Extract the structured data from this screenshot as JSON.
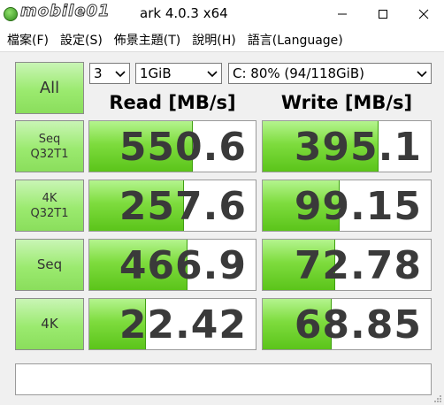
{
  "window": {
    "title": "CrystalDiskMark 4.0.3 x64",
    "title_visible": "ark 4.0.3 x64",
    "logo_watermark": "mobile01"
  },
  "menu": [
    {
      "label": "檔案(F)"
    },
    {
      "label": "設定(S)"
    },
    {
      "label": "佈景主題(T)"
    },
    {
      "label": "說明(H)"
    },
    {
      "label": "語言(Language)"
    }
  ],
  "controls": {
    "all_button": "All",
    "test_count": "3",
    "test_size": "1GiB",
    "drive": "C: 80% (94/118GiB)"
  },
  "headers": {
    "read": "Read [MB/s]",
    "write": "Write [MB/s]"
  },
  "rows": [
    {
      "label_line1": "Seq",
      "label_line2": "Q32T1",
      "read": "550.6",
      "write": "395.1",
      "read_fill": 0.62,
      "write_fill": 0.69
    },
    {
      "label_line1": "4K",
      "label_line2": "Q32T1",
      "read": "257.6",
      "write": "99.15",
      "read_fill": 0.57,
      "write_fill": 0.46
    },
    {
      "label_line1": "Seq",
      "label_line2": "",
      "read": "466.9",
      "write": "72.78",
      "read_fill": 0.59,
      "write_fill": 0.43
    },
    {
      "label_line1": "4K",
      "label_line2": "",
      "read": "22.42",
      "write": "68.85",
      "read_fill": 0.34,
      "write_fill": 0.41
    }
  ],
  "status": "",
  "colors": {
    "bar_green": "#7edc3e",
    "button_green": "#9bea6f",
    "value_text": "#3a3a3a"
  }
}
